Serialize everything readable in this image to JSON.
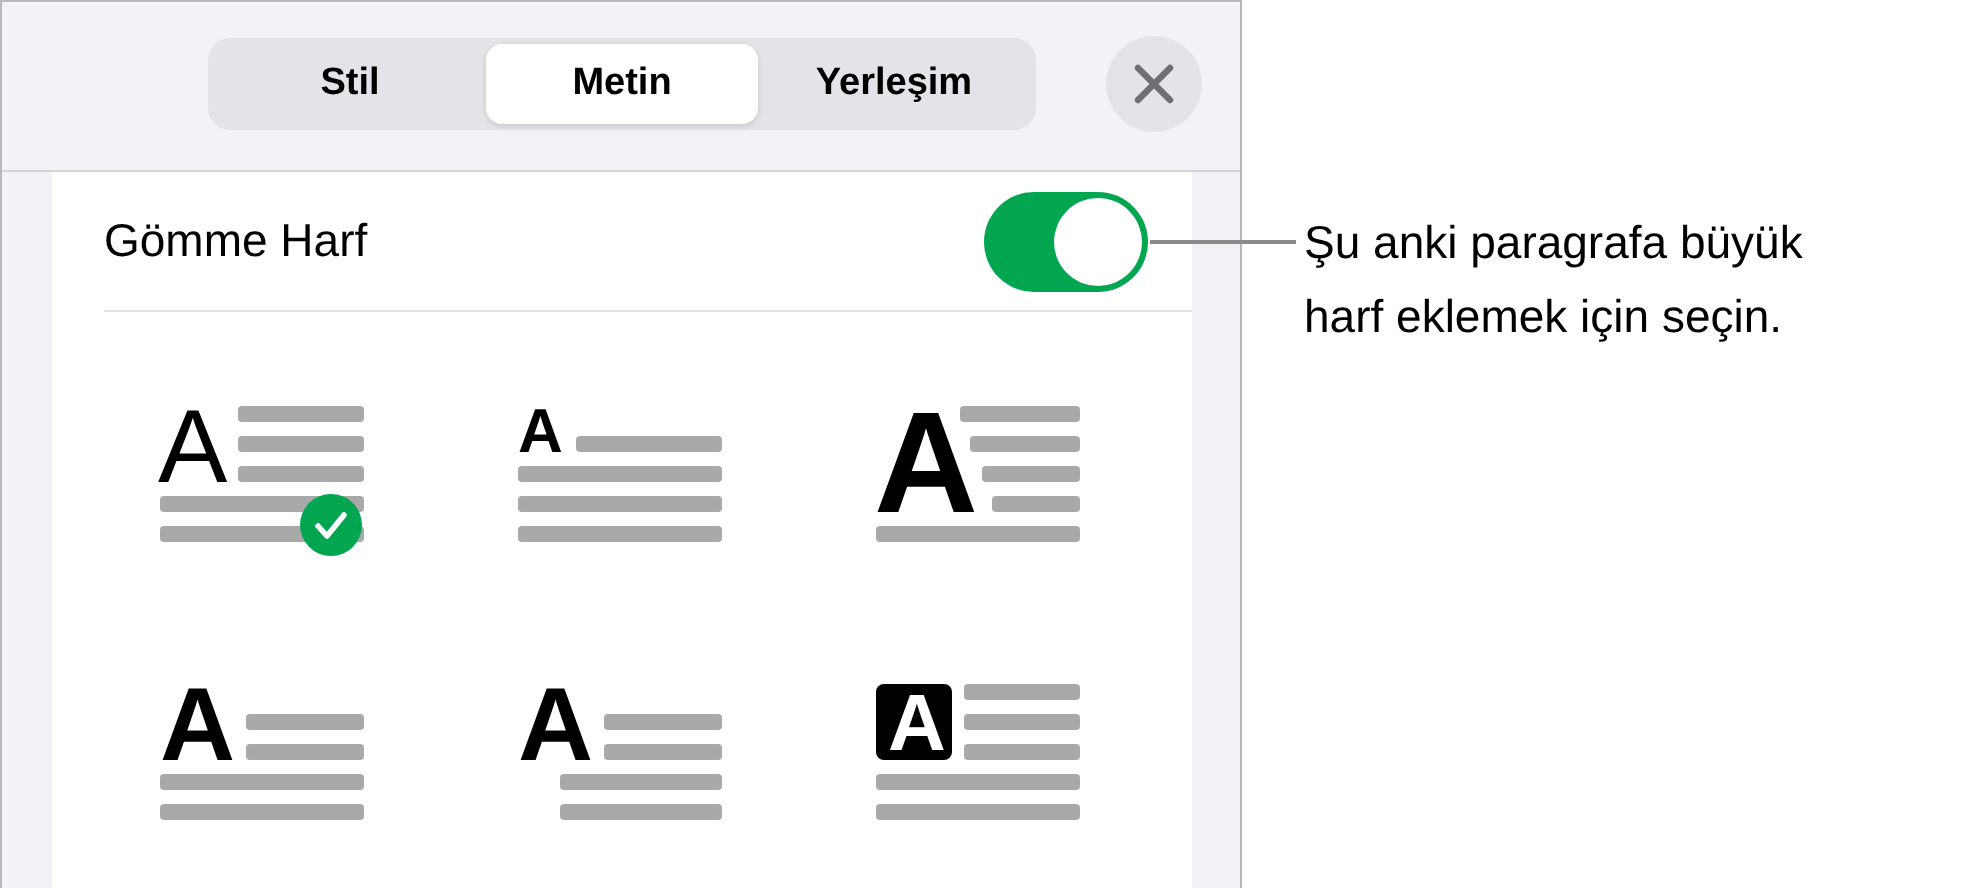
{
  "tabs": [
    {
      "label": "Stil",
      "selected": false
    },
    {
      "label": "Metin",
      "selected": true
    },
    {
      "label": "Yerleşim",
      "selected": false
    }
  ],
  "drop_cap": {
    "label": "Gömme Harf",
    "on": true
  },
  "styles": [
    {
      "kind": "raised",
      "letter": "A",
      "selected": true
    },
    {
      "kind": "small",
      "letter": "A",
      "selected": false
    },
    {
      "kind": "large",
      "letter": "A",
      "selected": false
    },
    {
      "kind": "bold",
      "letter": "A",
      "selected": false
    },
    {
      "kind": "indented",
      "letter": "A",
      "selected": false
    },
    {
      "kind": "boxed",
      "letter": "A",
      "selected": false
    }
  ],
  "callout": {
    "text": "Şu anki paragrafa büyük harf eklemek için seçin."
  }
}
